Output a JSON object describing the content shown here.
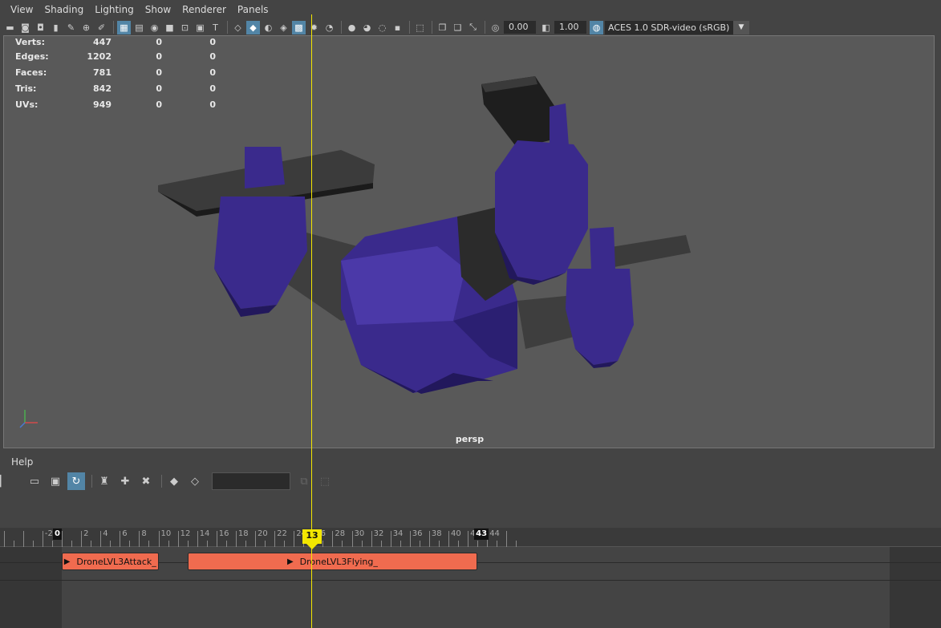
{
  "menu": [
    "View",
    "Shading",
    "Lighting",
    "Show",
    "Renderer",
    "Panels"
  ],
  "toolbar": {
    "exposure": "0.00",
    "gamma": "1.00",
    "colorspace": "ACES 1.0 SDR-video (sRGB)"
  },
  "hud": {
    "rows": [
      {
        "label": "Verts:",
        "v1": "447",
        "v2": "0",
        "v3": "0"
      },
      {
        "label": "Edges:",
        "v1": "1202",
        "v2": "0",
        "v3": "0"
      },
      {
        "label": "Faces:",
        "v1": "781",
        "v2": "0",
        "v3": "0"
      },
      {
        "label": "Tris:",
        "v1": "842",
        "v2": "0",
        "v3": "0"
      },
      {
        "label": "UVs:",
        "v1": "949",
        "v2": "0",
        "v3": "0"
      }
    ],
    "camera": "persp"
  },
  "lower": {
    "help": "Help"
  },
  "timeline": {
    "labels": [
      "-2",
      "0",
      "2",
      "4",
      "6",
      "8",
      "10",
      "12",
      "14",
      "16",
      "18",
      "20",
      "22",
      "24",
      "26",
      "28",
      "30",
      "32",
      "34",
      "36",
      "38",
      "40",
      "42",
      "44"
    ],
    "start_marker": "0",
    "end_marker": "43",
    "current_frame": "13",
    "clips": [
      {
        "name": "DroneLVL3Attack_",
        "start": 0,
        "end": 10
      },
      {
        "name": "DroneLVL3Flying_",
        "start": 13,
        "end": 43
      }
    ]
  },
  "colors": {
    "drone_body": "#3a2a8c",
    "clip": "#f06b4f",
    "playhead": "#f3e600",
    "active_button": "#5285a6"
  }
}
